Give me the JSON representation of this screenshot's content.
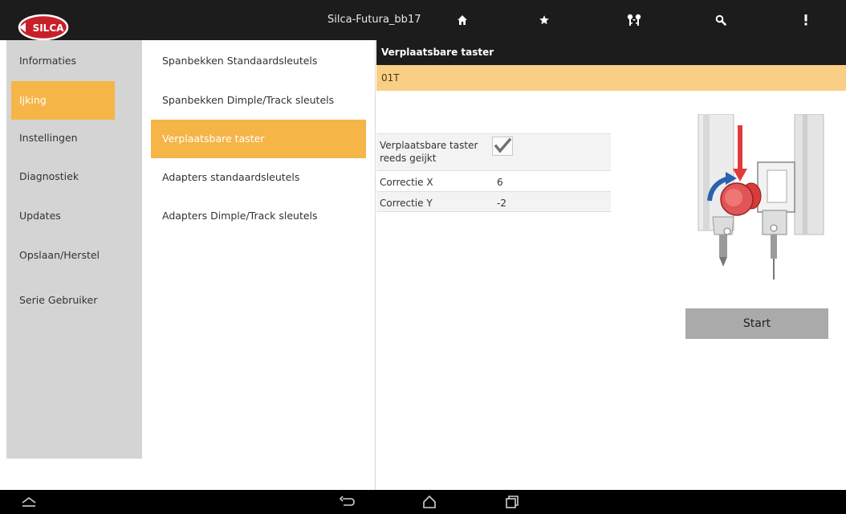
{
  "topbar": {
    "logo_text": "SILCA",
    "title": "Silca-Futura_bb17",
    "icons": [
      "home-icon",
      "star-icon",
      "keys-icon",
      "search-icon",
      "more-vert-icon"
    ]
  },
  "nav": {
    "items": [
      {
        "label": "Informaties"
      },
      {
        "label": "Ijking"
      },
      {
        "label": "Instellingen"
      },
      {
        "label": "Diagnostiek"
      },
      {
        "label": "Updates"
      },
      {
        "label": "Opslaan/Herstel"
      },
      {
        "label": "Serie Gebruiker"
      }
    ]
  },
  "list": {
    "items": [
      {
        "label": "Spanbekken Standaardsleutels"
      },
      {
        "label": "Spanbekken Dimple/Track sleutels"
      },
      {
        "label": "Verplaatsbare taster"
      },
      {
        "label": "Adapters standaardsleutels"
      },
      {
        "label": "Adapters Dimple/Track sleutels"
      }
    ]
  },
  "detail": {
    "header": "Verplaatsbare taster",
    "subheader": "01T",
    "rows": [
      {
        "label": "Verplaatsbare taster reeds geijkt",
        "checked": true
      },
      {
        "label": "Correctie X",
        "value": "6"
      },
      {
        "label": "Correctie Y",
        "value": "-2"
      }
    ],
    "start_label": "Start"
  },
  "bottombar": {
    "icons": [
      "collapse-icon",
      "back-icon",
      "home-outline-icon",
      "recent-apps-icon"
    ]
  },
  "colors": {
    "accent": "#f5b547",
    "subheader": "#f9cf86",
    "bar": "#1c1c1c",
    "nav_bg": "#d4d4d4",
    "button": "#aaaaaa",
    "logo_red": "#c8202a"
  }
}
